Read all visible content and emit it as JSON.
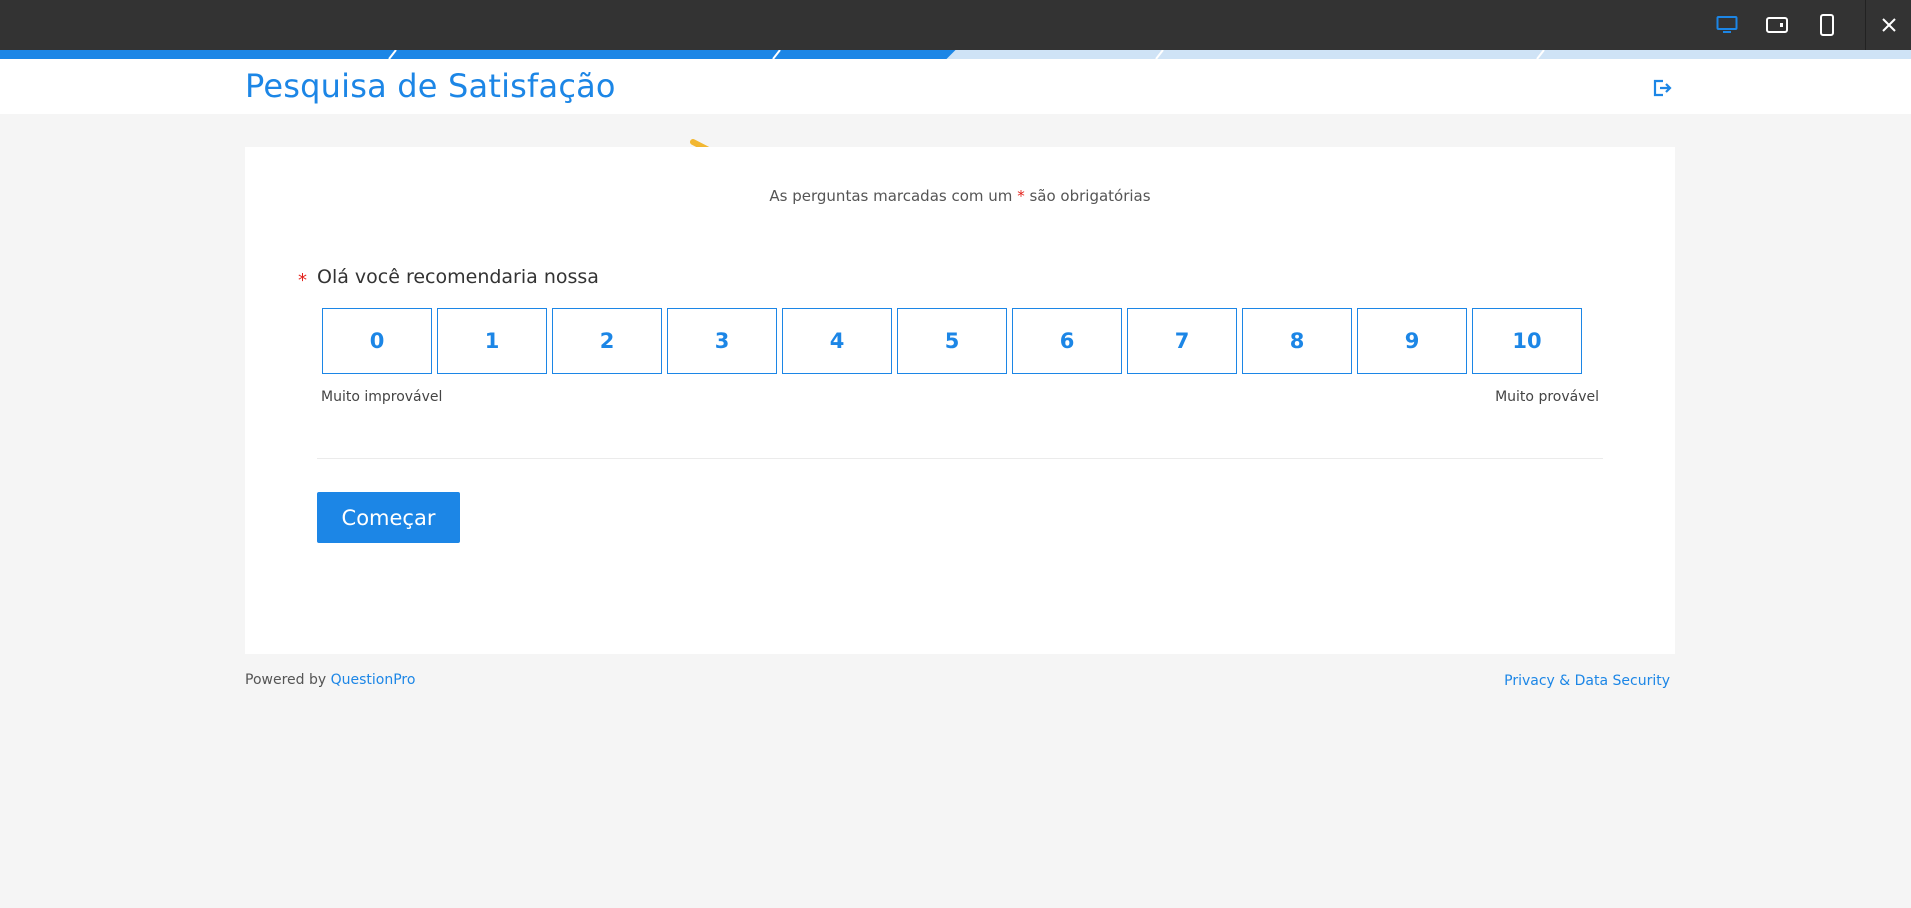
{
  "toolbar": {
    "devices": [
      "desktop",
      "tablet",
      "mobile"
    ],
    "active_device": "desktop",
    "close_icon": "close-icon"
  },
  "progress": {
    "fraction": 0.5
  },
  "header": {
    "title": "Pesquisa de Satisfação",
    "exit_icon": "exit-icon"
  },
  "survey": {
    "required_note_prefix": "As perguntas marcadas com um",
    "required_star": "*",
    "required_note_suffix": "são obrigatórias",
    "question_star": "*",
    "question": "Olá você recomendaria nossa",
    "scale": [
      "0",
      "1",
      "2",
      "3",
      "4",
      "5",
      "6",
      "7",
      "8",
      "9",
      "10"
    ],
    "low_label": "Muito improvável",
    "high_label": "Muito provável",
    "start_button": "Começar"
  },
  "footer": {
    "powered_by": "Powered by",
    "brand": "QuestionPro",
    "privacy": "Privacy & Data Security"
  },
  "colors": {
    "accent": "#1c86e6",
    "topbar": "#333333",
    "required": "#e3221b",
    "annotation_arrow": "#f2b731"
  }
}
